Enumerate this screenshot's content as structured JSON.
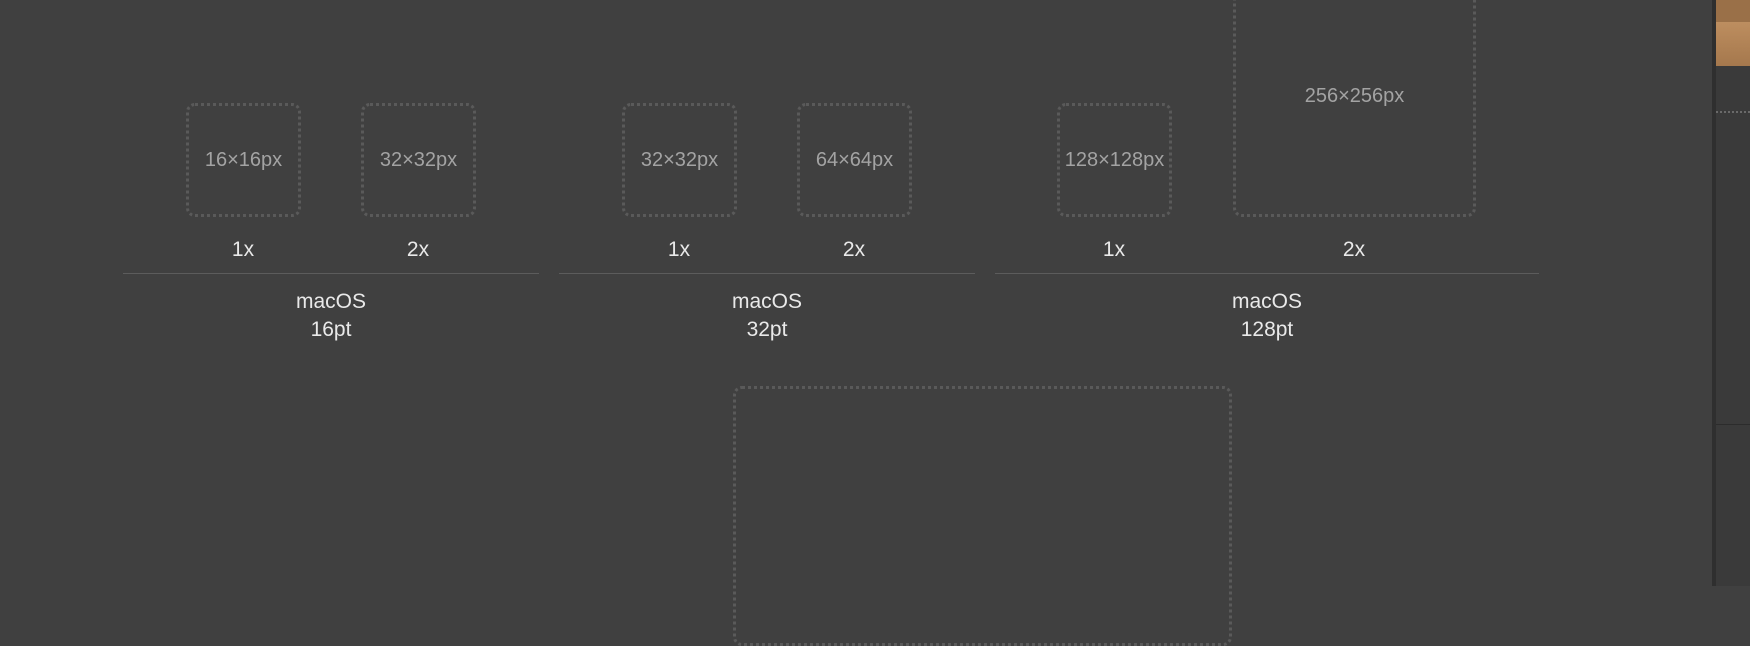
{
  "groups": [
    {
      "platform": "macOS",
      "size": "16pt",
      "slots": [
        {
          "pixel_label": "16×16px",
          "scale": "1x"
        },
        {
          "pixel_label": "32×32px",
          "scale": "2x"
        }
      ]
    },
    {
      "platform": "macOS",
      "size": "32pt",
      "slots": [
        {
          "pixel_label": "32×32px",
          "scale": "1x"
        },
        {
          "pixel_label": "64×64px",
          "scale": "2x"
        }
      ]
    },
    {
      "platform": "macOS",
      "size": "128pt",
      "slots": [
        {
          "pixel_label": "128×128px",
          "scale": "1x"
        },
        {
          "pixel_label": "256×256px",
          "scale": "2x"
        }
      ]
    }
  ],
  "colors": {
    "background": "#404040",
    "slot_border": "#5a5a5a",
    "slot_text": "#a3a3a3",
    "label_text": "#e9e9e9",
    "divider": "#5c5c5c",
    "accent_thumb": "#c79a6c"
  }
}
